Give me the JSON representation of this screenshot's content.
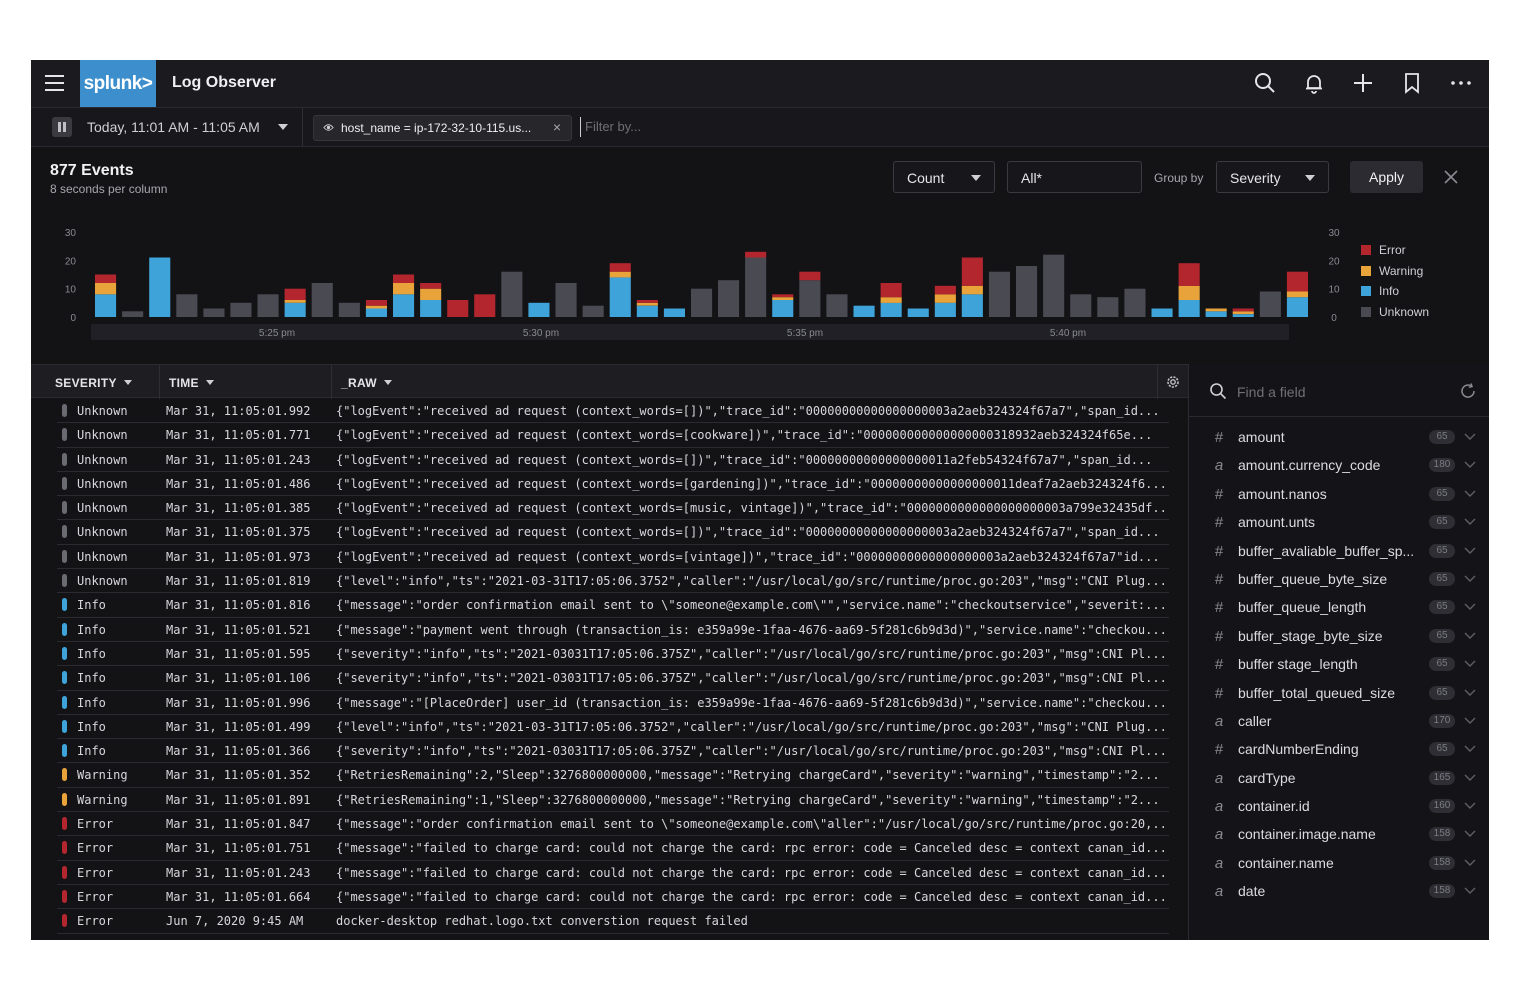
{
  "app": {
    "title": "Log Observer",
    "logo_text": "splunk>"
  },
  "icons": {
    "menu": "hamburger-icon",
    "search": "search-icon",
    "notifications": "bell-icon",
    "add": "plus-icon",
    "bookmark": "bookmark-icon",
    "more": "ellipsis-icon"
  },
  "filterbar": {
    "time_range": "Today, 11:01 AM - 11:05 AM",
    "chip_label": "host_name = ip-172-32-10-115.us...",
    "filter_placeholder": "Filter by..."
  },
  "summary": {
    "events": "877 Events",
    "per_column": "8 seconds per column"
  },
  "controls": {
    "count": "Count",
    "all": "All*",
    "group_by_label": "Group by",
    "group_by_value": "Severity",
    "apply": "Apply"
  },
  "colors": {
    "Error": "#b3262e",
    "Warning": "#e8a33a",
    "Info": "#3ea3d8",
    "Unknown": "#4a4a52"
  },
  "chart_data": {
    "type": "bar",
    "stacked": true,
    "ylim": [
      0,
      30
    ],
    "yticks": [
      "30",
      "20",
      "10",
      "0"
    ],
    "xticks": [
      "5:25 pm",
      "5:30 pm",
      "5:35 pm",
      "5:40 pm"
    ],
    "legend": [
      "Error",
      "Warning",
      "Info",
      "Unknown"
    ],
    "legend_position": "right",
    "bars": [
      {
        "Info": 8,
        "Warning": 4,
        "Error": 3
      },
      {
        "Unknown": 2
      },
      {
        "Info": 21
      },
      {
        "Unknown": 8
      },
      {
        "Unknown": 3
      },
      {
        "Unknown": 5
      },
      {
        "Unknown": 8
      },
      {
        "Info": 5,
        "Warning": 1,
        "Error": 4
      },
      {
        "Unknown": 12
      },
      {
        "Unknown": 5
      },
      {
        "Info": 3,
        "Warning": 1,
        "Error": 2
      },
      {
        "Info": 8,
        "Warning": 4,
        "Error": 3
      },
      {
        "Info": 6,
        "Warning": 4,
        "Error": 2
      },
      {
        "Error": 6
      },
      {
        "Error": 8
      },
      {
        "Unknown": 16
      },
      {
        "Info": 5
      },
      {
        "Unknown": 12
      },
      {
        "Unknown": 4
      },
      {
        "Info": 14,
        "Warning": 2,
        "Error": 3
      },
      {
        "Info": 4,
        "Warning": 1,
        "Error": 1
      },
      {
        "Info": 3
      },
      {
        "Unknown": 10
      },
      {
        "Unknown": 13
      },
      {
        "Unknown": 21,
        "Error": 2
      },
      {
        "Info": 6,
        "Warning": 1,
        "Error": 1
      },
      {
        "Unknown": 13,
        "Error": 3
      },
      {
        "Unknown": 8
      },
      {
        "Info": 4
      },
      {
        "Info": 5,
        "Warning": 2,
        "Error": 5
      },
      {
        "Info": 3
      },
      {
        "Info": 5,
        "Warning": 3,
        "Error": 3
      },
      {
        "Info": 8,
        "Warning": 3,
        "Error": 10
      },
      {
        "Unknown": 16
      },
      {
        "Unknown": 18
      },
      {
        "Unknown": 22
      },
      {
        "Unknown": 8
      },
      {
        "Unknown": 7
      },
      {
        "Unknown": 10
      },
      {
        "Info": 3
      },
      {
        "Info": 6,
        "Warning": 5,
        "Error": 8
      },
      {
        "Info": 2,
        "Warning": 1
      },
      {
        "Info": 1,
        "Warning": 1,
        "Error": 1
      },
      {
        "Unknown": 9
      },
      {
        "Info": 7,
        "Warning": 2,
        "Error": 7
      }
    ]
  },
  "table": {
    "columns": [
      "SEVERITY",
      "TIME",
      "_RAW"
    ],
    "rows": [
      {
        "severity": "Unknown",
        "time": "Mar 31, 11:05:01.992",
        "raw": "{\"logEvent\":\"received ad request (context_words=[])\",\"trace_id\":\"00000000000000000003a2aeb324324f67a7\",\"span_id..."
      },
      {
        "severity": "Unknown",
        "time": "Mar 31, 11:05:01.771",
        "raw": "{\"logEvent\":\"received ad request (context_words=[cookware])\",\"trace_id\":\"000000000000000000318932aeb324324f65e..."
      },
      {
        "severity": "Unknown",
        "time": "Mar 31, 11:05:01.243",
        "raw": "{\"logEvent\":\"received ad request (context_words=[])\",\"trace_id\":\"00000000000000000011a2feb54324f67a7\",\"span_id..."
      },
      {
        "severity": "Unknown",
        "time": "Mar 31, 11:05:01.486",
        "raw": "{\"logEvent\":\"received ad request (context_words=[gardening])\",\"trace_id\":\"00000000000000000011deaf7a2aeb324324f6..."
      },
      {
        "severity": "Unknown",
        "time": "Mar 31, 11:05:01.385",
        "raw": "{\"logEvent\":\"received ad request (context_words=[music, vintage])\",\"trace_id\":\"0000000000000000000003a799e32435df..."
      },
      {
        "severity": "Unknown",
        "time": "Mar 31, 11:05:01.375",
        "raw": "{\"logEvent\":\"received ad request (context_words=[])\",\"trace_id\":\"00000000000000000003a2aeb324324f67a7\",\"span_id..."
      },
      {
        "severity": "Unknown",
        "time": "Mar 31, 11:05:01.973",
        "raw": "{\"logEvent\":\"received ad request (context_words=[vintage])\",\"trace_id\":\"00000000000000000003a2aeb324324f67a7\"id..."
      },
      {
        "severity": "Unknown",
        "time": "Mar 31, 11:05:01.819",
        "raw": "{\"level\":\"info\",\"ts\":\"2021-03-31T17:05:06.3752\",\"caller\":\"/usr/local/go/src/runtime/proc.go:203\",\"msg\":\"CNI Plug..."
      },
      {
        "severity": "Info",
        "time": "Mar 31, 11:05:01.816",
        "raw": "{\"message\":\"order confirmation email sent to \\\"someone@example.com\\\"\",\"service.name\":\"checkoutservice\",\"severit:..."
      },
      {
        "severity": "Info",
        "time": "Mar 31, 11:05:01.521",
        "raw": "{\"message\":\"payment went through (transaction_is: e359a99e-1faa-4676-aa69-5f281c6b9d3d)\",\"service.name\":\"checkou..."
      },
      {
        "severity": "Info",
        "time": "Mar 31, 11:05:01.595",
        "raw": "{\"severity\":\"info\",\"ts\":\"2021-03031T17:05:06.375Z\",\"caller\":\"/usr/local/go/src/runtime/proc.go:203\",\"msg\":CNI Pl..."
      },
      {
        "severity": "Info",
        "time": "Mar 31, 11:05:01.106",
        "raw": "{\"severity\":\"info\",\"ts\":\"2021-03031T17:05:06.375Z\",\"caller\":\"/usr/local/go/src/runtime/proc.go:203\",\"msg\":CNI Pl..."
      },
      {
        "severity": "Info",
        "time": "Mar 31, 11:05:01.996",
        "raw": "{\"message\":\"[PlaceOrder] user_id (transaction_is: e359a99e-1faa-4676-aa69-5f281c6b9d3d)\",\"service.name\":\"checkou..."
      },
      {
        "severity": "Info",
        "time": "Mar 31, 11:05:01.499",
        "raw": "{\"level\":\"info\",\"ts\":\"2021-03-31T17:05:06.3752\",\"caller\":\"/usr/local/go/src/runtime/proc.go:203\",\"msg\":\"CNI Plug..."
      },
      {
        "severity": "Info",
        "time": "Mar 31, 11:05:01.366",
        "raw": "{\"severity\":\"info\",\"ts\":\"2021-03031T17:05:06.375Z\",\"caller\":\"/usr/local/go/src/runtime/proc.go:203\",\"msg\":CNI Pl..."
      },
      {
        "severity": "Warning",
        "time": "Mar 31, 11:05:01.352",
        "raw": "{\"RetriesRemaining\":2,\"Sleep\":3276800000000,\"message\":\"Retrying chargeCard\",\"severity\":\"warning\",\"timestamp\":\"2..."
      },
      {
        "severity": "Warning",
        "time": "Mar 31, 11:05:01.891",
        "raw": "{\"RetriesRemaining\":1,\"Sleep\":3276800000000,\"message\":\"Retrying chargeCard\",\"severity\":\"warning\",\"timestamp\":\"2..."
      },
      {
        "severity": "Error",
        "time": "Mar 31, 11:05:01.847",
        "raw": "{\"message\":\"order confirmation email sent to \\\"someone@example.com\\\"aller\":\"/usr/local/go/src/runtime/proc.go:20,..."
      },
      {
        "severity": "Error",
        "time": "Mar 31, 11:05:01.751",
        "raw": "{\"message\":\"failed to charge card: could not charge the card: rpc error: code = Canceled desc = context canan_id..."
      },
      {
        "severity": "Error",
        "time": "Mar 31, 11:05:01.243",
        "raw": "{\"message\":\"failed to charge card: could not charge the card: rpc error: code = Canceled desc = context canan_id..."
      },
      {
        "severity": "Error",
        "time": "Mar 31, 11:05:01.664",
        "raw": "{\"message\":\"failed to charge card: could not charge the card: rpc error: code = Canceled desc = context canan_id..."
      },
      {
        "severity": "Error",
        "time": "Jun 7, 2020 9:45 AM",
        "raw": "docker-desktop     redhat.logo.txt     converstion request failed"
      }
    ]
  },
  "fields": {
    "search_placeholder": "Find a field",
    "items": [
      {
        "type": "#",
        "name": "amount",
        "count": "65"
      },
      {
        "type": "a",
        "name": "amount.currency_code",
        "count": "180"
      },
      {
        "type": "#",
        "name": "amount.nanos",
        "count": "65"
      },
      {
        "type": "#",
        "name": "amount.unts",
        "count": "65"
      },
      {
        "type": "#",
        "name": "buffer_avaliable_buffer_sp...",
        "count": "65"
      },
      {
        "type": "#",
        "name": "buffer_queue_byte_size",
        "count": "65"
      },
      {
        "type": "#",
        "name": "buffer_queue_length",
        "count": "65"
      },
      {
        "type": "#",
        "name": "buffer_stage_byte_size",
        "count": "65"
      },
      {
        "type": "#",
        "name": "buffer stage_length",
        "count": "65"
      },
      {
        "type": "#",
        "name": "buffer_total_queued_size",
        "count": "65"
      },
      {
        "type": "a",
        "name": "caller",
        "count": "170"
      },
      {
        "type": "#",
        "name": "cardNumberEnding",
        "count": "65"
      },
      {
        "type": "a",
        "name": "cardType",
        "count": "165"
      },
      {
        "type": "a",
        "name": "container.id",
        "count": "160"
      },
      {
        "type": "a",
        "name": "container.image.name",
        "count": "158"
      },
      {
        "type": "a",
        "name": "container.name",
        "count": "158"
      },
      {
        "type": "a",
        "name": "date",
        "count": "158"
      }
    ]
  }
}
